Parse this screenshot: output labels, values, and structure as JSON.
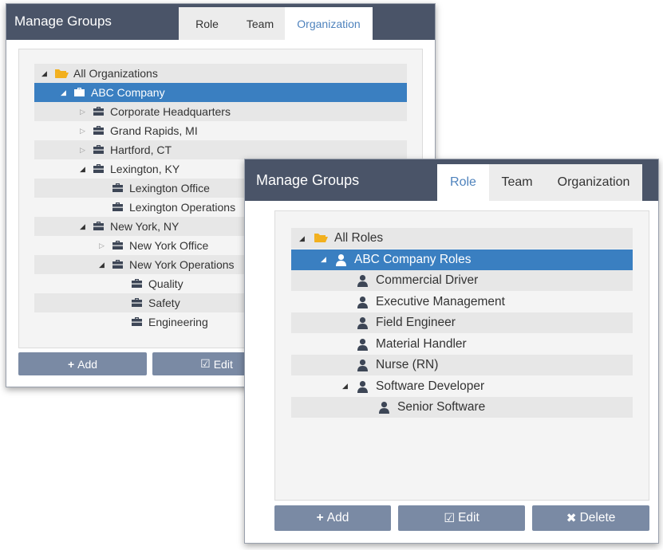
{
  "panel_back": {
    "title": "Manage Groups",
    "tabs": [
      {
        "label": "Role",
        "active": false
      },
      {
        "label": "Team",
        "active": false
      },
      {
        "label": "Organization",
        "active": true
      }
    ],
    "tree": [
      {
        "label": "All Organizations",
        "depth": 0,
        "icon": "folder-open-icon",
        "toggle": "expanded",
        "selected": false
      },
      {
        "label": "ABC Company",
        "depth": 1,
        "icon": "briefcase-icon",
        "toggle": "expanded",
        "selected": true
      },
      {
        "label": "Corporate Headquarters",
        "depth": 2,
        "icon": "briefcase-icon",
        "toggle": "collapsed",
        "selected": false
      },
      {
        "label": "Grand Rapids, MI",
        "depth": 2,
        "icon": "briefcase-icon",
        "toggle": "collapsed",
        "selected": false
      },
      {
        "label": "Hartford, CT",
        "depth": 2,
        "icon": "briefcase-icon",
        "toggle": "collapsed",
        "selected": false
      },
      {
        "label": "Lexington, KY",
        "depth": 2,
        "icon": "briefcase-icon",
        "toggle": "expanded",
        "selected": false
      },
      {
        "label": "Lexington Office",
        "depth": 3,
        "icon": "briefcase-icon",
        "toggle": "none",
        "selected": false
      },
      {
        "label": "Lexington Operations",
        "depth": 3,
        "icon": "briefcase-icon",
        "toggle": "none",
        "selected": false
      },
      {
        "label": "New York, NY",
        "depth": 2,
        "icon": "briefcase-icon",
        "toggle": "expanded",
        "selected": false
      },
      {
        "label": "New York Office",
        "depth": 3,
        "icon": "briefcase-icon",
        "toggle": "collapsed",
        "selected": false
      },
      {
        "label": "New York Operations",
        "depth": 3,
        "icon": "briefcase-icon",
        "toggle": "expanded",
        "selected": false
      },
      {
        "label": "Quality",
        "depth": 4,
        "icon": "briefcase-icon",
        "toggle": "none",
        "selected": false
      },
      {
        "label": "Safety",
        "depth": 4,
        "icon": "briefcase-icon",
        "toggle": "none",
        "selected": false
      },
      {
        "label": "Engineering",
        "depth": 4,
        "icon": "briefcase-icon",
        "toggle": "none",
        "selected": false
      }
    ],
    "buttons": {
      "add": "Add",
      "edit": "Edit"
    }
  },
  "panel_front": {
    "title": "Manage Groups",
    "tabs": [
      {
        "label": "Role",
        "active": true
      },
      {
        "label": "Team",
        "active": false
      },
      {
        "label": "Organization",
        "active": false
      }
    ],
    "tree": [
      {
        "label": "All Roles",
        "depth": 0,
        "icon": "folder-open-icon",
        "toggle": "expanded",
        "selected": false
      },
      {
        "label": "ABC Company Roles",
        "depth": 1,
        "icon": "person-icon",
        "toggle": "expanded",
        "selected": true
      },
      {
        "label": "Commercial Driver",
        "depth": 2,
        "icon": "person-icon",
        "toggle": "none",
        "selected": false
      },
      {
        "label": "Executive Management",
        "depth": 2,
        "icon": "person-icon",
        "toggle": "none",
        "selected": false
      },
      {
        "label": "Field Engineer",
        "depth": 2,
        "icon": "person-icon",
        "toggle": "none",
        "selected": false
      },
      {
        "label": "Material Handler",
        "depth": 2,
        "icon": "person-icon",
        "toggle": "none",
        "selected": false
      },
      {
        "label": "Nurse (RN)",
        "depth": 2,
        "icon": "person-icon",
        "toggle": "none",
        "selected": false
      },
      {
        "label": "Software Developer",
        "depth": 2,
        "icon": "person-icon",
        "toggle": "expanded",
        "selected": false
      },
      {
        "label": "Senior Software",
        "depth": 3,
        "icon": "person-icon",
        "toggle": "none",
        "selected": false
      }
    ],
    "buttons": {
      "add": "Add",
      "edit": "Edit",
      "delete": "Delete"
    }
  },
  "colors": {
    "header": "#4a5468",
    "selected_row": "#3a7fc1",
    "active_tab_text": "#4f83bd",
    "button": "#7a8aa4",
    "folder": "#f2b01e",
    "icon_dark": "#3d4656"
  },
  "glyphs": {
    "expanded": "◢",
    "collapsed": "▷",
    "plus": "+",
    "edit": "☑",
    "delete": "✖"
  }
}
